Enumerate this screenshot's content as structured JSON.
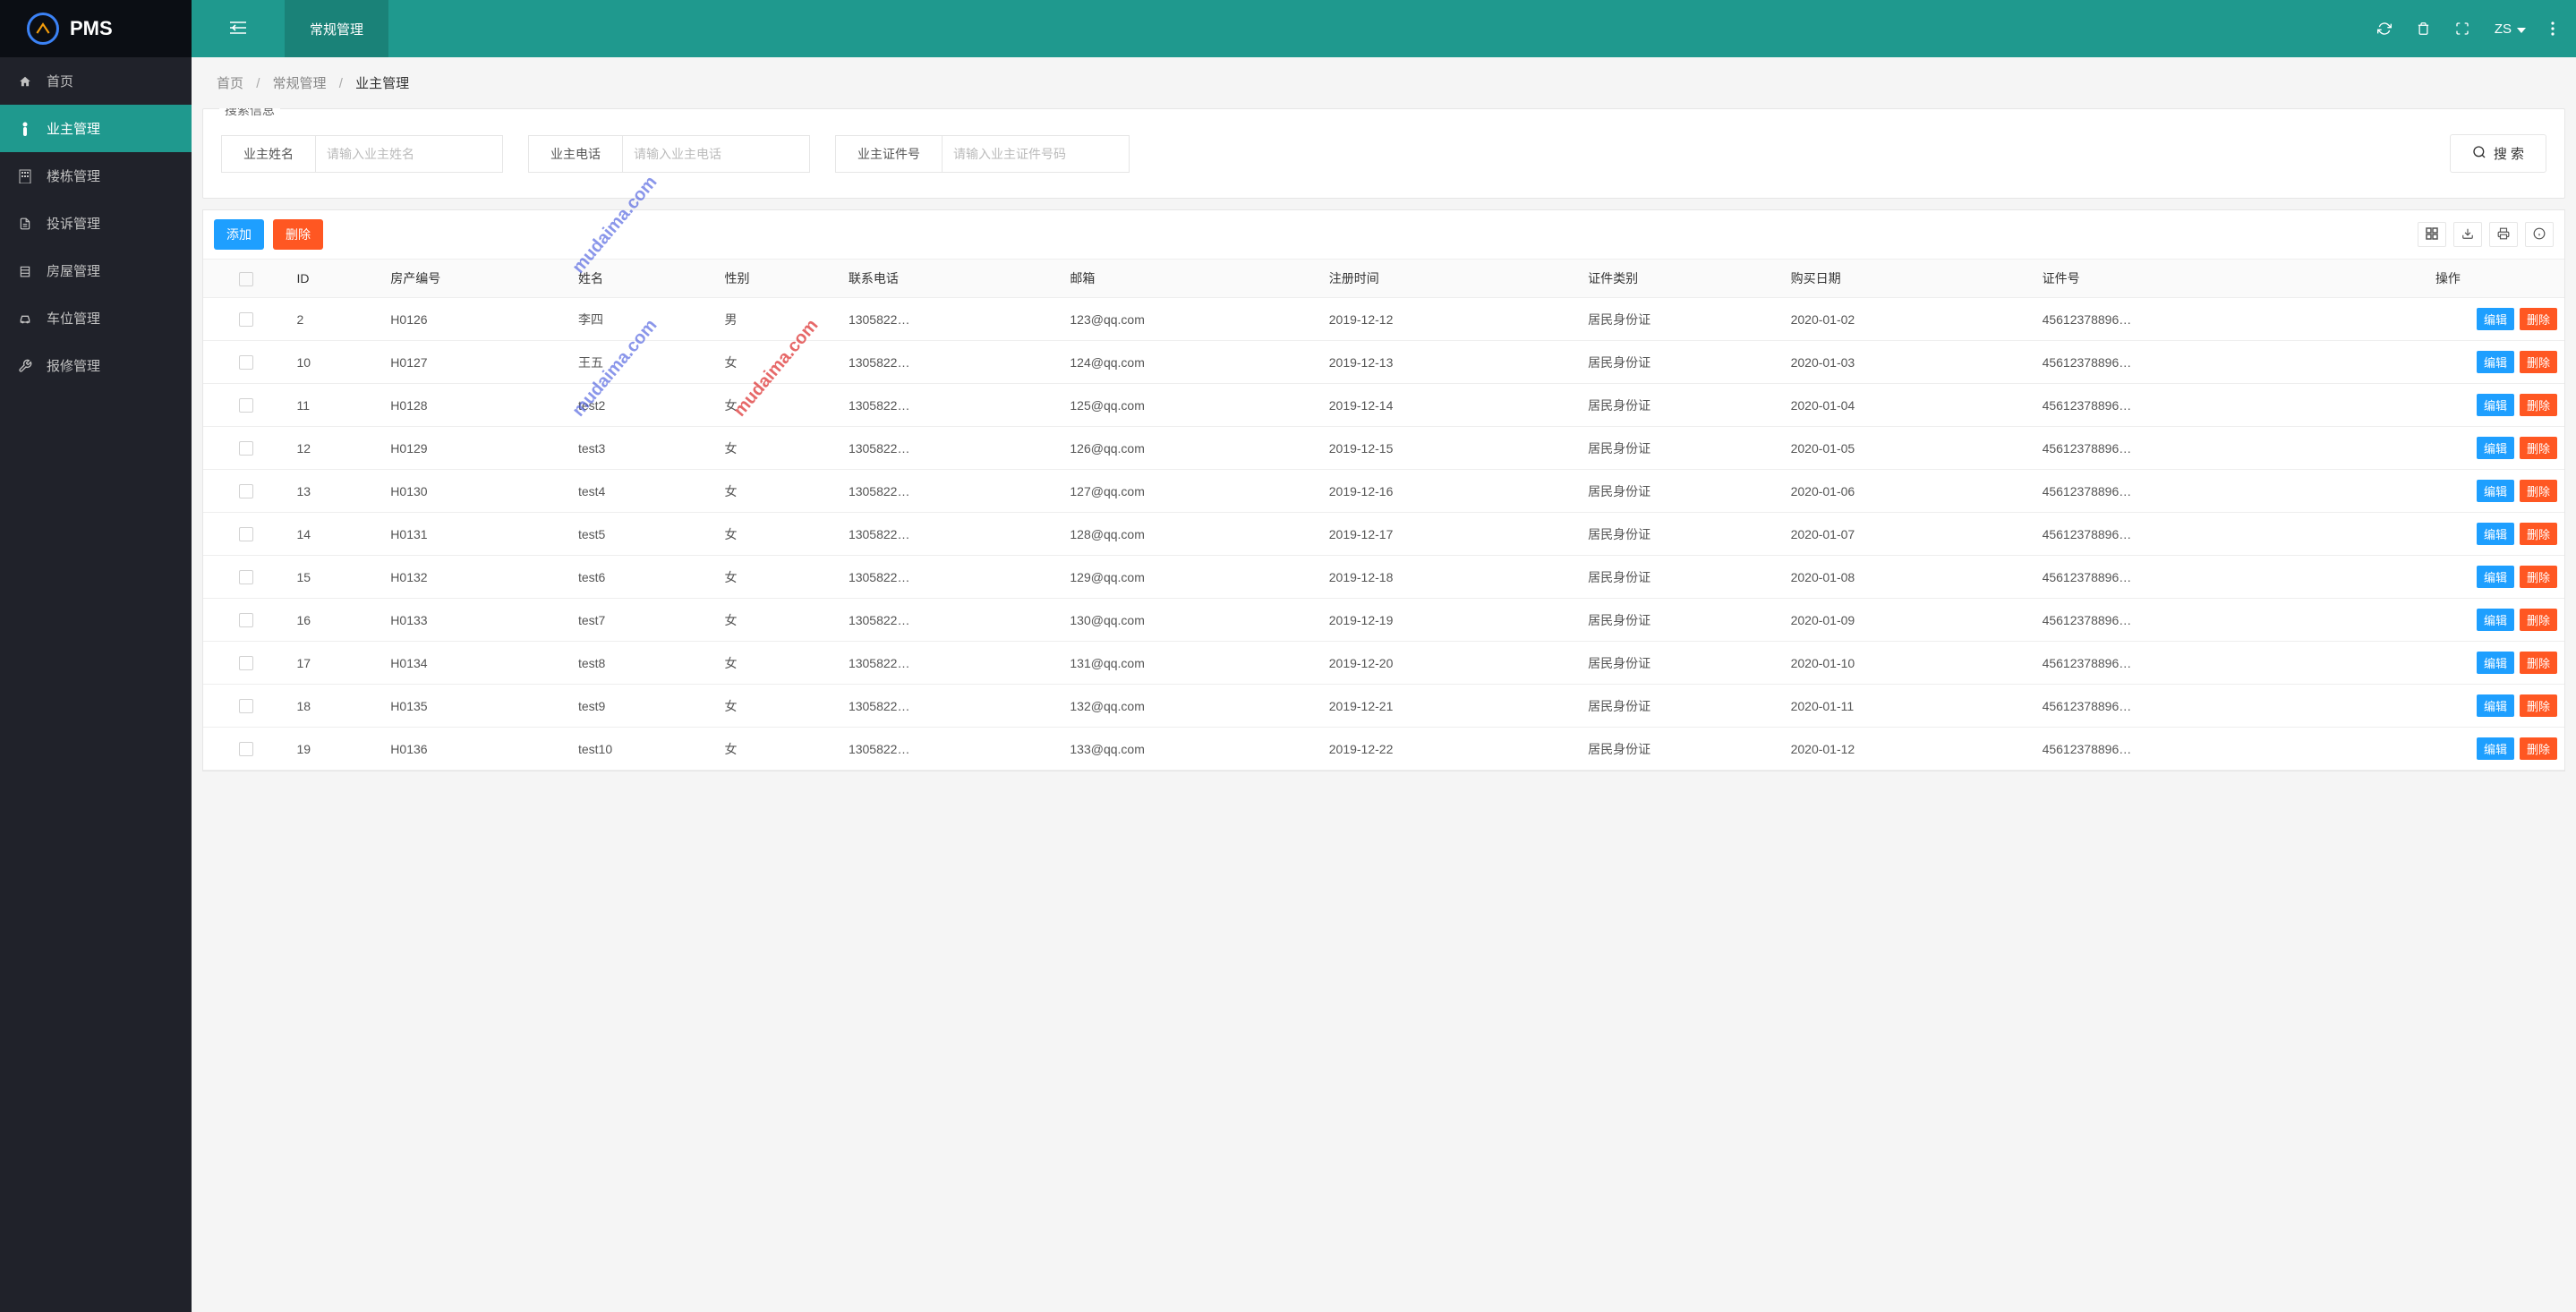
{
  "brand": "PMS",
  "header": {
    "tab_label": "常规管理",
    "user": "ZS"
  },
  "breadcrumb": {
    "home": "首页",
    "section": "常规管理",
    "page": "业主管理"
  },
  "sidebar": {
    "items": [
      {
        "label": "首页",
        "icon": "home"
      },
      {
        "label": "业主管理",
        "icon": "person",
        "active": true
      },
      {
        "label": "楼栋管理",
        "icon": "building"
      },
      {
        "label": "投诉管理",
        "icon": "doc"
      },
      {
        "label": "房屋管理",
        "icon": "house"
      },
      {
        "label": "车位管理",
        "icon": "car"
      },
      {
        "label": "报修管理",
        "icon": "wrench"
      }
    ]
  },
  "search": {
    "title": "搜索信息",
    "fields": [
      {
        "label": "业主姓名",
        "placeholder": "请输入业主姓名"
      },
      {
        "label": "业主电话",
        "placeholder": "请输入业主电话"
      },
      {
        "label": "业主证件号",
        "placeholder": "请输入业主证件号码"
      }
    ],
    "button": "搜 索"
  },
  "toolbar": {
    "add": "添加",
    "delete": "删除"
  },
  "table": {
    "headers": {
      "id": "ID",
      "house_no": "房产编号",
      "name": "姓名",
      "gender": "性别",
      "phone": "联系电话",
      "email": "邮箱",
      "reg_date": "注册时间",
      "id_type": "证件类别",
      "buy_date": "购买日期",
      "id_no": "证件号",
      "ops": "操作"
    },
    "op_labels": {
      "edit": "编辑",
      "delete": "删除"
    },
    "rows": [
      {
        "id": "2",
        "house_no": "H0126",
        "name": "李四",
        "gender": "男",
        "phone": "1305822…",
        "email": "123@qq.com",
        "reg_date": "2019-12-12",
        "id_type": "居民身份证",
        "buy_date": "2020-01-02",
        "id_no": "45612378896…"
      },
      {
        "id": "10",
        "house_no": "H0127",
        "name": "王五",
        "gender": "女",
        "phone": "1305822…",
        "email": "124@qq.com",
        "reg_date": "2019-12-13",
        "id_type": "居民身份证",
        "buy_date": "2020-01-03",
        "id_no": "45612378896…"
      },
      {
        "id": "11",
        "house_no": "H0128",
        "name": "test2",
        "gender": "女",
        "phone": "1305822…",
        "email": "125@qq.com",
        "reg_date": "2019-12-14",
        "id_type": "居民身份证",
        "buy_date": "2020-01-04",
        "id_no": "45612378896…"
      },
      {
        "id": "12",
        "house_no": "H0129",
        "name": "test3",
        "gender": "女",
        "phone": "1305822…",
        "email": "126@qq.com",
        "reg_date": "2019-12-15",
        "id_type": "居民身份证",
        "buy_date": "2020-01-05",
        "id_no": "45612378896…"
      },
      {
        "id": "13",
        "house_no": "H0130",
        "name": "test4",
        "gender": "女",
        "phone": "1305822…",
        "email": "127@qq.com",
        "reg_date": "2019-12-16",
        "id_type": "居民身份证",
        "buy_date": "2020-01-06",
        "id_no": "45612378896…"
      },
      {
        "id": "14",
        "house_no": "H0131",
        "name": "test5",
        "gender": "女",
        "phone": "1305822…",
        "email": "128@qq.com",
        "reg_date": "2019-12-17",
        "id_type": "居民身份证",
        "buy_date": "2020-01-07",
        "id_no": "45612378896…"
      },
      {
        "id": "15",
        "house_no": "H0132",
        "name": "test6",
        "gender": "女",
        "phone": "1305822…",
        "email": "129@qq.com",
        "reg_date": "2019-12-18",
        "id_type": "居民身份证",
        "buy_date": "2020-01-08",
        "id_no": "45612378896…"
      },
      {
        "id": "16",
        "house_no": "H0133",
        "name": "test7",
        "gender": "女",
        "phone": "1305822…",
        "email": "130@qq.com",
        "reg_date": "2019-12-19",
        "id_type": "居民身份证",
        "buy_date": "2020-01-09",
        "id_no": "45612378896…"
      },
      {
        "id": "17",
        "house_no": "H0134",
        "name": "test8",
        "gender": "女",
        "phone": "1305822…",
        "email": "131@qq.com",
        "reg_date": "2019-12-20",
        "id_type": "居民身份证",
        "buy_date": "2020-01-10",
        "id_no": "45612378896…"
      },
      {
        "id": "18",
        "house_no": "H0135",
        "name": "test9",
        "gender": "女",
        "phone": "1305822…",
        "email": "132@qq.com",
        "reg_date": "2019-12-21",
        "id_type": "居民身份证",
        "buy_date": "2020-01-11",
        "id_no": "45612378896…"
      },
      {
        "id": "19",
        "house_no": "H0136",
        "name": "test10",
        "gender": "女",
        "phone": "1305822…",
        "email": "133@qq.com",
        "reg_date": "2019-12-22",
        "id_type": "居民身份证",
        "buy_date": "2020-01-12",
        "id_no": "45612378896…"
      }
    ]
  },
  "watermark": "mudaima.com"
}
